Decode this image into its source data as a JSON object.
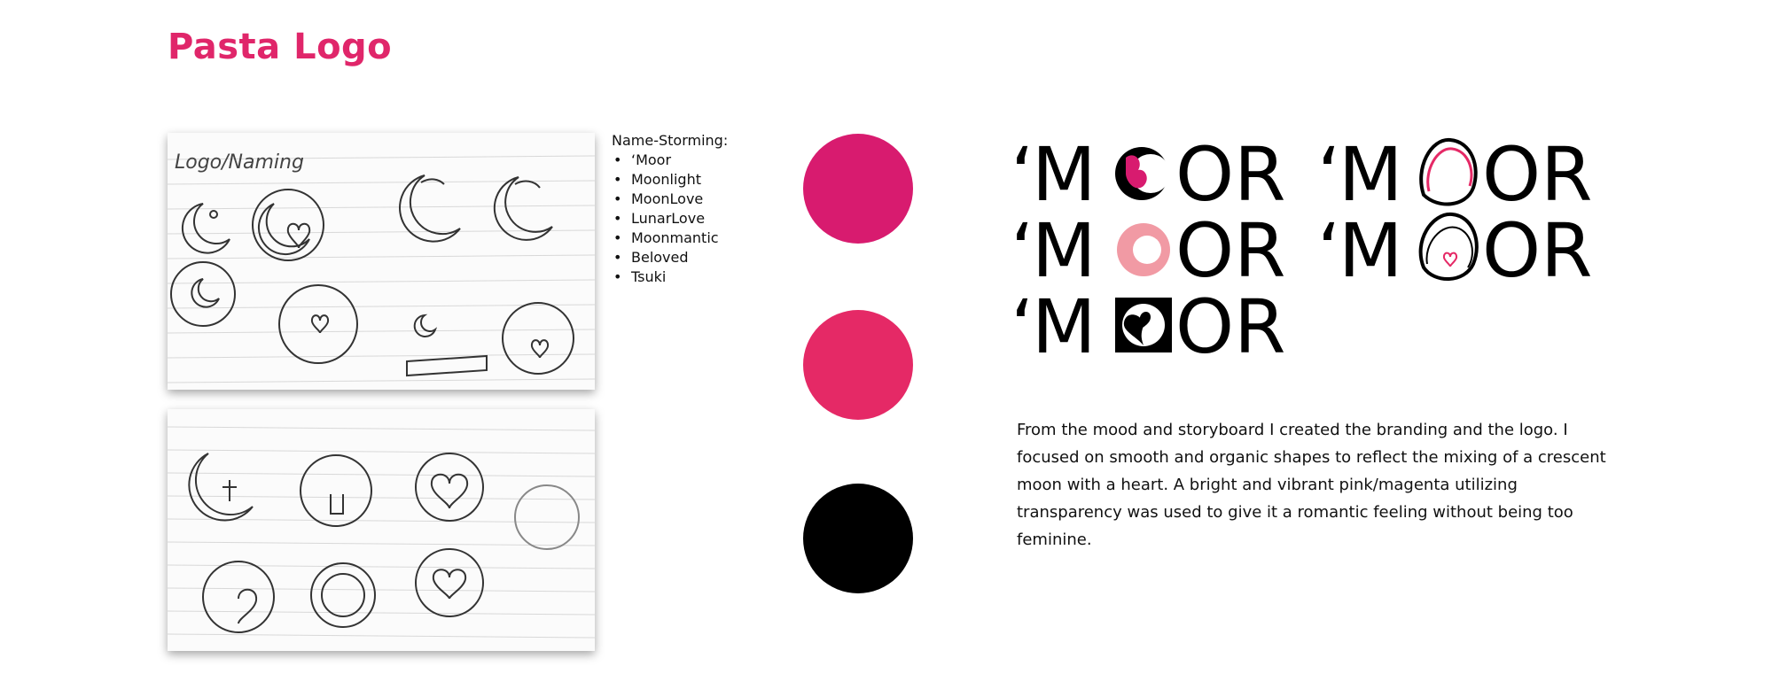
{
  "title": "Pasta Logo",
  "sketch_caption": "Logo/Naming",
  "names": {
    "heading": "Name-Storming:",
    "items": [
      "‘Moor",
      "Moonlight",
      "MoonLove",
      "LunarLove",
      "Moonmantic",
      "Beloved",
      "Tsuki"
    ]
  },
  "swatches": [
    {
      "name": "magenta",
      "color": "#d81b6f"
    },
    {
      "name": "pink",
      "color": "#e52966"
    },
    {
      "name": "black",
      "color": "#000000"
    }
  ],
  "logo": {
    "apostrophe": "‘",
    "m": "M",
    "tail": "OR",
    "full": "‘MOOR"
  },
  "description": "From the mood and storyboard I created the branding and the logo. I focused on smooth and organic shapes to reflect the mixing of a crescent moon with a heart. A bright and vibrant pink/magenta utilizing transparency was used  to give it a romantic feeling without being too feminine."
}
